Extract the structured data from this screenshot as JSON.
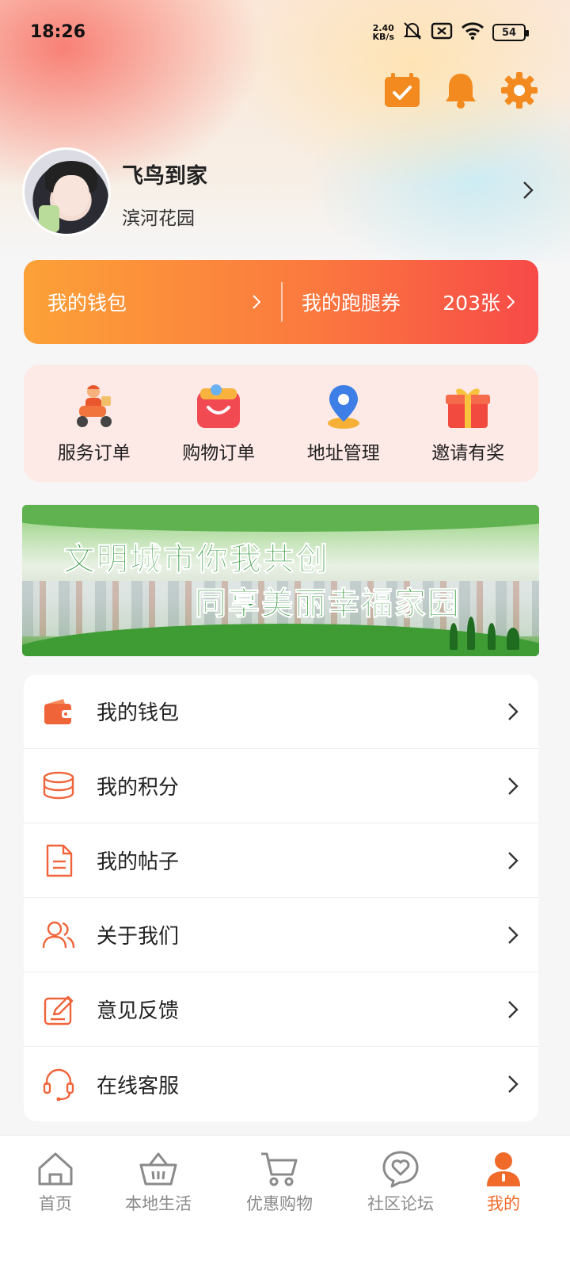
{
  "status_bar": {
    "time": "18:26",
    "net_speed_value": "2.40",
    "net_speed_unit": "KB/s",
    "battery": "54"
  },
  "header_icons": [
    "calendar-check-icon",
    "bell-icon",
    "gear-icon"
  ],
  "profile": {
    "name": "飞鸟到家",
    "community": "滨河花园"
  },
  "wallet_bar": {
    "wallet_label": "我的钱包",
    "coupon_label": "我的跑腿券",
    "coupon_count": "203张"
  },
  "orders": [
    {
      "label": "服务订单",
      "icon": "delivery-scooter-icon"
    },
    {
      "label": "购物订单",
      "icon": "shopping-bag-icon"
    },
    {
      "label": "地址管理",
      "icon": "location-pin-icon"
    },
    {
      "label": "邀请有奖",
      "icon": "gift-box-icon"
    }
  ],
  "banner": {
    "line1": "文明城市你我共创",
    "line2": "同享美丽幸福家园"
  },
  "menu": [
    {
      "label": "我的钱包",
      "icon": "wallet-icon"
    },
    {
      "label": " 我的积分",
      "icon": "coins-stack-icon"
    },
    {
      "label": "我的帖子",
      "icon": "document-icon"
    },
    {
      "label": "关于我们",
      "icon": "users-icon"
    },
    {
      "label": "意见反馈",
      "icon": "edit-feedback-icon"
    },
    {
      "label": "在线客服",
      "icon": "headset-icon"
    }
  ],
  "tabs": [
    {
      "label": "首页",
      "icon": "home-icon",
      "active": false
    },
    {
      "label": "本地生活",
      "icon": "basket-icon",
      "active": false
    },
    {
      "label": "优惠购物",
      "icon": "cart-icon",
      "active": false
    },
    {
      "label": "社区论坛",
      "icon": "heart-chat-icon",
      "active": false
    },
    {
      "label": "我的",
      "icon": "user-icon",
      "active": true
    }
  ],
  "colors": {
    "accent": "#f06a2a",
    "wallet_gradient_start": "#fca138",
    "wallet_gradient_end": "#f74a48",
    "order_card_bg": "#fde9e6",
    "inactive_tab": "#8a8a8a"
  }
}
